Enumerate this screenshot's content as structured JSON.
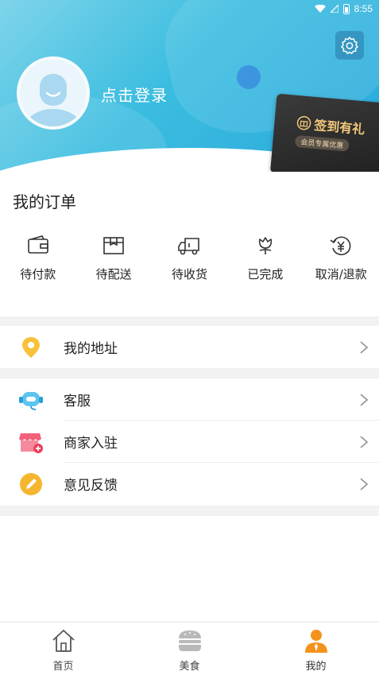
{
  "status_bar": {
    "time": "8:55"
  },
  "profile": {
    "login_text": "点击登录"
  },
  "signin_card": {
    "title": "签到有礼",
    "subtitle": "会员专属优惠"
  },
  "orders": {
    "title": "我的订单",
    "items": [
      {
        "label": "待付款",
        "icon": "wallet-icon"
      },
      {
        "label": "待配送",
        "icon": "box-icon"
      },
      {
        "label": "待收货",
        "icon": "truck-icon"
      },
      {
        "label": "已完成",
        "icon": "flower-icon"
      },
      {
        "label": "取消/退款",
        "icon": "refund-icon"
      }
    ]
  },
  "menu_group1": [
    {
      "label": "我的地址",
      "icon": "location-pin-icon"
    }
  ],
  "menu_group2": [
    {
      "label": "客服",
      "icon": "customer-service-icon"
    },
    {
      "label": "商家入驻",
      "icon": "store-icon"
    },
    {
      "label": "意见反馈",
      "icon": "pencil-icon"
    }
  ],
  "tabbar": [
    {
      "label": "首页",
      "icon": "home-icon",
      "active": false
    },
    {
      "label": "美食",
      "icon": "burger-icon",
      "active": false
    },
    {
      "label": "我的",
      "icon": "user-icon",
      "active": true
    }
  ],
  "colors": {
    "accent": "#2aa9dc",
    "active_tab": "#f5921b",
    "signin_gold": "#f3c77a"
  }
}
